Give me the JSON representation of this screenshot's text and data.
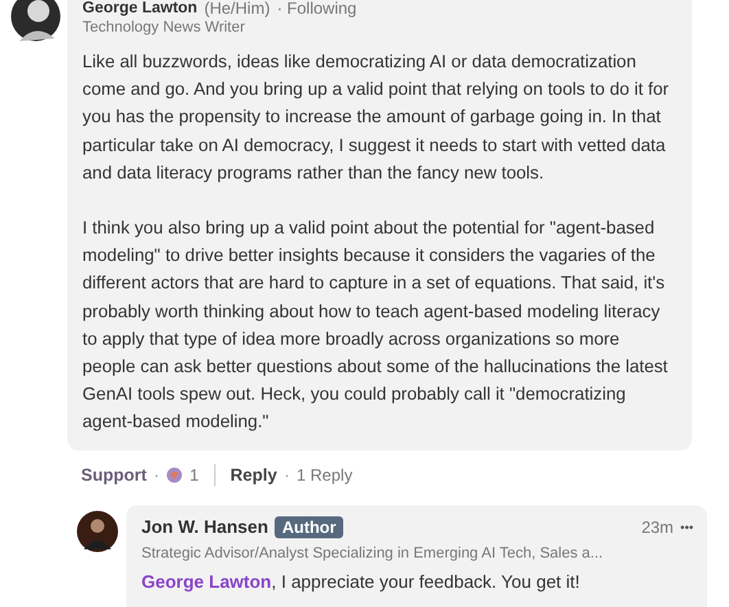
{
  "comment": {
    "author": "George Lawton",
    "pronouns": "(He/Him)",
    "connection": "· Following",
    "headline": "Technology News Writer",
    "paragraphs": [
      "Like all buzzwords, ideas like democratizing AI or data democratization come and go. And you bring up a valid point that relying on tools to do it for you has the propensity to increase the amount of garbage going in. In that particular take on AI democracy, I suggest it needs to start with vetted data and data literacy programs rather than the fancy new tools.",
      "I think you also bring up a valid point about the potential for \"agent-based modeling\" to drive better insights because it considers the vagaries of the different actors that are hard to capture in a set of equations. That said, it's probably worth thinking about how to teach agent-based modeling literacy to apply that type of idea more broadly across organizations so more people can ask better questions about some of the hallucinations the latest GenAI tools spew out. Heck, you could probably call it \"democratizing agent-based modeling.\""
    ]
  },
  "actions": {
    "support": "Support",
    "separator_1": "·",
    "reaction_count": "1",
    "reply": "Reply",
    "separator_2": "·",
    "replies": "1 Reply"
  },
  "reply": {
    "author": "Jon W. Hansen",
    "badge": "Author",
    "time": "23m",
    "menu": "•••",
    "headline": "Strategic Advisor/Analyst Specializing in Emerging AI Tech, Sales a...",
    "mention": "George Lawton",
    "text": ", I appreciate your feedback. You get it!"
  }
}
